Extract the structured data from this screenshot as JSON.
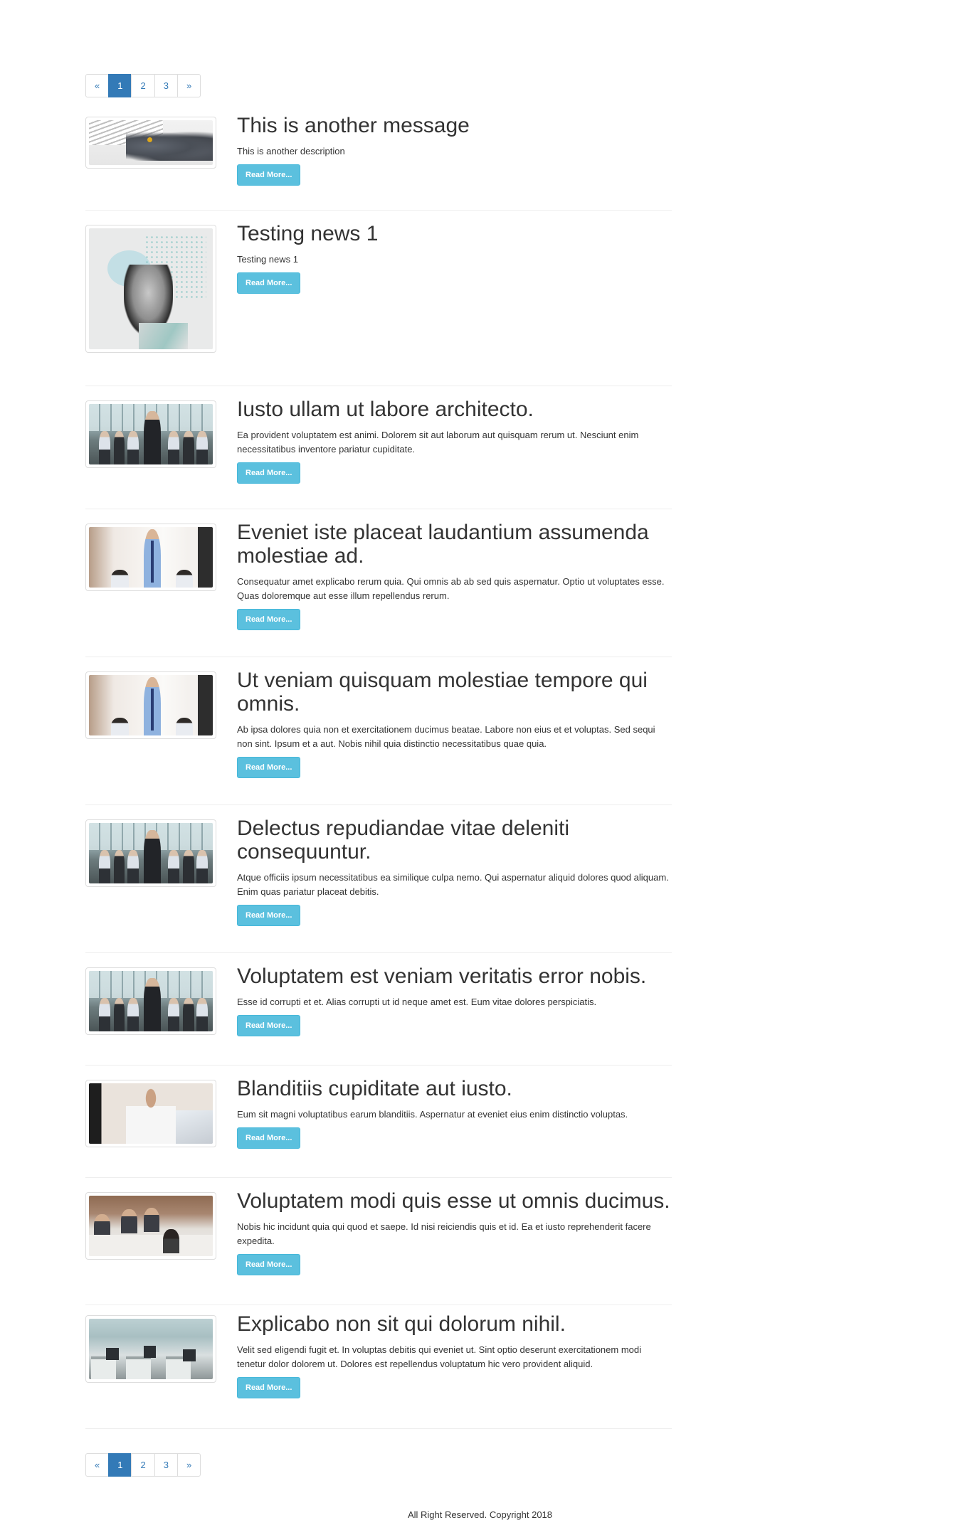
{
  "pagination": {
    "prev": "«",
    "pages": [
      "1",
      "2",
      "3"
    ],
    "active_page": "1",
    "next": "»"
  },
  "items": [
    {
      "title": "This is another message",
      "description": "This is another description",
      "button": "Read More...",
      "image": "cat-photo"
    },
    {
      "title": "Testing news 1",
      "description": "Testing news 1",
      "button": "Read More...",
      "image": "abstract-portrait-art"
    },
    {
      "title": "Iusto ullam ut labore architecto.",
      "description": "Ea provident voluptatem est animi. Dolorem sit aut laborum aut quisquam rerum ut. Nesciunt enim necessitatibus inventore pariatur cupiditate.",
      "button": "Read More...",
      "image": "office-team-photo"
    },
    {
      "title": "Eveniet iste placeat laudantium assumenda molestiae ad.",
      "description": "Consequatur amet explicabo rerum quia. Qui omnis ab ab sed quis aspernatur. Optio ut voluptates esse. Quas doloremque aut esse illum repellendus rerum.",
      "button": "Read More...",
      "image": "presenter-photo"
    },
    {
      "title": "Ut veniam quisquam molestiae tempore qui omnis.",
      "description": "Ab ipsa dolores quia non et exercitationem ducimus beatae. Labore non eius et et voluptas. Sed sequi non sint. Ipsum et a aut. Nobis nihil quia distinctio necessitatibus quae quia.",
      "button": "Read More...",
      "image": "presenter-photo"
    },
    {
      "title": "Delectus repudiandae vitae deleniti consequuntur.",
      "description": "Atque officiis ipsum necessitatibus ea similique culpa nemo. Qui aspernatur aliquid dolores quod aliquam. Enim quas pariatur placeat debitis.",
      "button": "Read More...",
      "image": "office-team-photo"
    },
    {
      "title": "Voluptatem est veniam veritatis error nobis.",
      "description": "Esse id corrupti et et. Alias corrupti ut id neque amet est. Eum vitae dolores perspiciatis.",
      "button": "Read More...",
      "image": "office-team-photo"
    },
    {
      "title": "Blanditiis cupiditate aut iusto.",
      "description": "Eum sit magni voluptatibus earum blanditiis. Aspernatur at eveniet eius enim distinctio voluptas.",
      "button": "Read More...",
      "image": "phone-call-photo"
    },
    {
      "title": "Voluptatem modi quis esse ut omnis ducimus.",
      "description": "Nobis hic incidunt quia qui quod et saepe. Id nisi reiciendis quis et id. Ea et iusto reprehenderit facere expedita.",
      "button": "Read More...",
      "image": "meeting-photo"
    },
    {
      "title": "Explicabo non sit qui dolorum nihil.",
      "description": "Velit sed eligendi fugit et. In voluptas debitis qui eveniet ut. Sint optio deserunt exercitationem modi tenetur dolor dolorem ut. Dolores est repellendus voluptatum hic vero provident aliquid.",
      "button": "Read More...",
      "image": "open-office-photo"
    }
  ],
  "footer": {
    "text": "All Right Reserved. Copyright 2018"
  }
}
